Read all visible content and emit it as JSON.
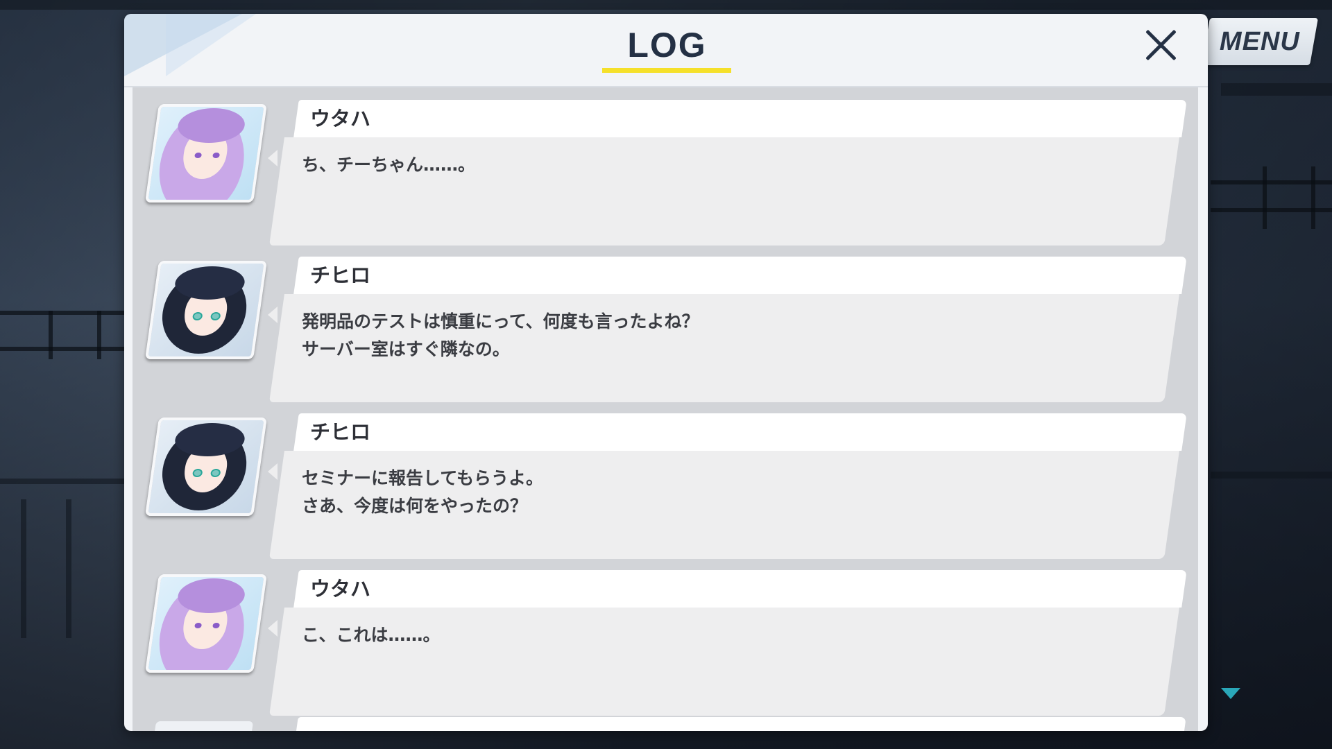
{
  "header": {
    "title": "LOG",
    "close_icon": "close-icon",
    "accent_color": "#f5e02a"
  },
  "menu": {
    "label": "MENU"
  },
  "entries": [
    {
      "name": "ウタハ",
      "text": "ち、チーちゃん……。",
      "avatar_icon": "utaha-portrait"
    },
    {
      "name": "チヒロ",
      "text": "発明品のテストは慎重にって、何度も言ったよね？\nサーバー室はすぐ隣なの。",
      "avatar_icon": "chihiro-portrait"
    },
    {
      "name": "チヒロ",
      "text": "セミナーに報告してもらうよ。\nさあ、今度は何をやったの？",
      "avatar_icon": "chihiro-portrait"
    },
    {
      "name": "ウタハ",
      "text": "こ、これは……。",
      "avatar_icon": "utaha-portrait"
    }
  ],
  "scroll_indicator_icon": "scroll-down-arrow-icon"
}
